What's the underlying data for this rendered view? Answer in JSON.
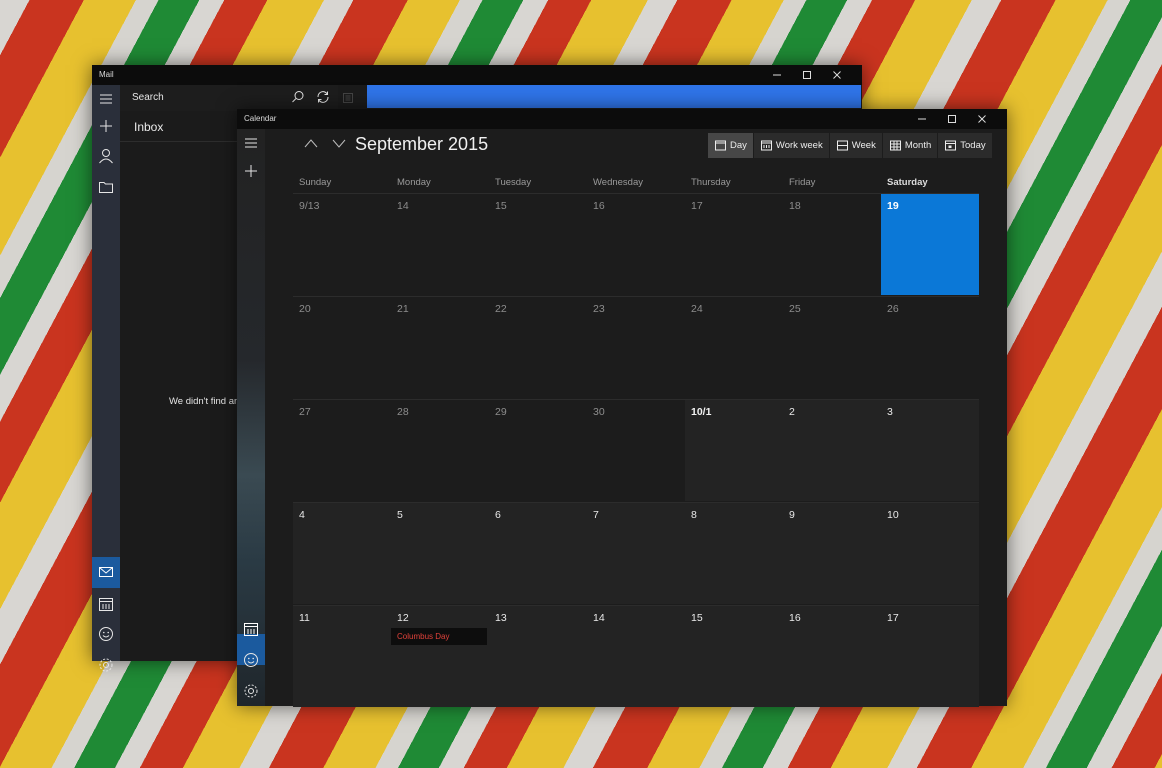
{
  "mail": {
    "title": "Mail",
    "search_label": "Search",
    "folder": "Inbox",
    "empty_message": "We didn't find an"
  },
  "calendar": {
    "title": "Calendar",
    "month_title": "September 2015",
    "toolbar": [
      "Day",
      "Work week",
      "Week",
      "Month",
      "Today"
    ],
    "days_of_week": [
      "Sunday",
      "Monday",
      "Tuesday",
      "Wednesday",
      "Thursday",
      "Friday",
      "Saturday"
    ],
    "weeks": [
      [
        "9/13",
        "14",
        "15",
        "16",
        "17",
        "18",
        "19"
      ],
      [
        "20",
        "21",
        "22",
        "23",
        "24",
        "25",
        "26"
      ],
      [
        "27",
        "28",
        "29",
        "30",
        "10/1",
        "2",
        "3"
      ],
      [
        "4",
        "5",
        "6",
        "7",
        "8",
        "9",
        "10"
      ],
      [
        "11",
        "12",
        "13",
        "14",
        "15",
        "16",
        "17"
      ]
    ],
    "today": "19",
    "events": [
      {
        "date": "12",
        "title": "Columbus Day",
        "color": "#e0413a"
      }
    ]
  },
  "colors": {
    "accent": "#0b78d7",
    "mail_blue_bar": "#2f74e8",
    "selection": "#1b5a9e"
  }
}
